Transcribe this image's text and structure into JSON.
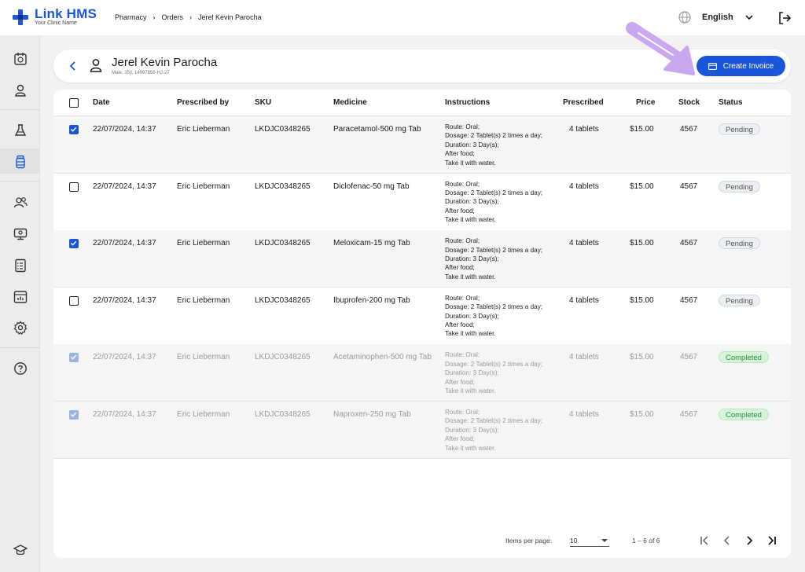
{
  "app": {
    "name": "Link HMS",
    "subtitle": "Your Clinic Name"
  },
  "breadcrumb": [
    "Pharmacy",
    "Orders",
    "Jerel Kevin Parocha"
  ],
  "language": "English",
  "patient": {
    "name": "Jerel Kevin Parocha",
    "meta": "Male, 35y, 14097856-HJ-27"
  },
  "actions": {
    "create_invoice": "Create Invoice"
  },
  "table": {
    "headers": {
      "date": "Date",
      "prescribed_by": "Prescribed by",
      "sku": "SKU",
      "medicine": "Medicine",
      "instructions": "Instructions",
      "prescribed": "Prescribed",
      "price": "Price",
      "stock": "Stock",
      "status": "Status"
    },
    "rows": [
      {
        "checked": true,
        "disabled": false,
        "date": "22/07/2024, 14:37",
        "prescribed_by": "Eric Lieberman",
        "sku": "LKDJC0348265",
        "medicine": "Paracetamol-500 mg Tab",
        "instructions": [
          "Route: Oral;",
          "Dosage: 2 Tablet(s) 2 times a day;",
          "Duration: 3 Day(s);",
          "After food;",
          "Take it with water."
        ],
        "prescribed": "4 tablets",
        "price": "$15.00",
        "stock": "4567",
        "status": "Pending"
      },
      {
        "checked": false,
        "disabled": false,
        "date": "22/07/2024, 14:37",
        "prescribed_by": "Eric Lieberman",
        "sku": "LKDJC0348265",
        "medicine": "Diclofenac-50 mg Tab",
        "instructions": [
          "Route: Oral;",
          "Dosage: 2 Tablet(s) 2 times a day;",
          "Duration: 3 Day(s);",
          "After food;",
          "Take it with water."
        ],
        "prescribed": "4 tablets",
        "price": "$15.00",
        "stock": "4567",
        "status": "Pending"
      },
      {
        "checked": true,
        "disabled": false,
        "date": "22/07/2024, 14:37",
        "prescribed_by": "Eric Lieberman",
        "sku": "LKDJC0348265",
        "medicine": "Meloxicam-15 mg Tab",
        "instructions": [
          "Route: Oral;",
          "Dosage: 2 Tablet(s) 2 times a day;",
          "Duration: 3 Day(s);",
          "After food;",
          "Take it with water."
        ],
        "prescribed": "4 tablets",
        "price": "$15.00",
        "stock": "4567",
        "status": "Pending"
      },
      {
        "checked": false,
        "disabled": false,
        "date": "22/07/2024, 14:37",
        "prescribed_by": "Eric Lieberman",
        "sku": "LKDJC0348265",
        "medicine": "Ibuprofen-200 mg Tab",
        "instructions": [
          "Route: Oral;",
          "Dosage: 2 Tablet(s) 2 times a day;",
          "Duration: 3 Day(s);",
          "After food;",
          "Take it with water."
        ],
        "prescribed": "4 tablets",
        "price": "$15.00",
        "stock": "4567",
        "status": "Pending"
      },
      {
        "checked": true,
        "disabled": true,
        "date": "22/07/2024, 14:37",
        "prescribed_by": "Eric Lieberman",
        "sku": "LKDJC0348265",
        "medicine": "Acetaminophen-500 mg Tab",
        "instructions": [
          "Route: Oral;",
          "Dosage: 2 Tablet(s) 2 times a day;",
          "Duration: 3 Day(s);",
          "After food;",
          "Take it with water."
        ],
        "prescribed": "4 tablets",
        "price": "$15.00",
        "stock": "4567",
        "status": "Completed"
      },
      {
        "checked": true,
        "disabled": true,
        "date": "22/07/2024, 14:37",
        "prescribed_by": "Eric Lieberman",
        "sku": "LKDJC0348265",
        "medicine": "Naproxen-250 mg Tab",
        "instructions": [
          "Route: Oral;",
          "Dosage: 2 Tablet(s) 2 times a day;",
          "Duration: 3 Day(s);",
          "After food;",
          "Take it with water."
        ],
        "prescribed": "4 tablets",
        "price": "$15.00",
        "stock": "4567",
        "status": "Completed"
      }
    ]
  },
  "pagination": {
    "items_per_page_label": "Items per page:",
    "items_per_page": "10",
    "range": "1 – 6 of 6"
  },
  "sidebar": {
    "items": [
      "appointments-icon",
      "patient-icon",
      "lab-icon",
      "pharmacy-icon",
      "staff-icon",
      "monitor-icon",
      "reports-icon",
      "analytics-icon",
      "settings-icon",
      "help-icon",
      "learning-icon"
    ],
    "active": "pharmacy-icon"
  },
  "colors": {
    "accent": "#1a56db",
    "annotation_arrow": "#c9a8f0",
    "completed": "#1e8e3e"
  }
}
